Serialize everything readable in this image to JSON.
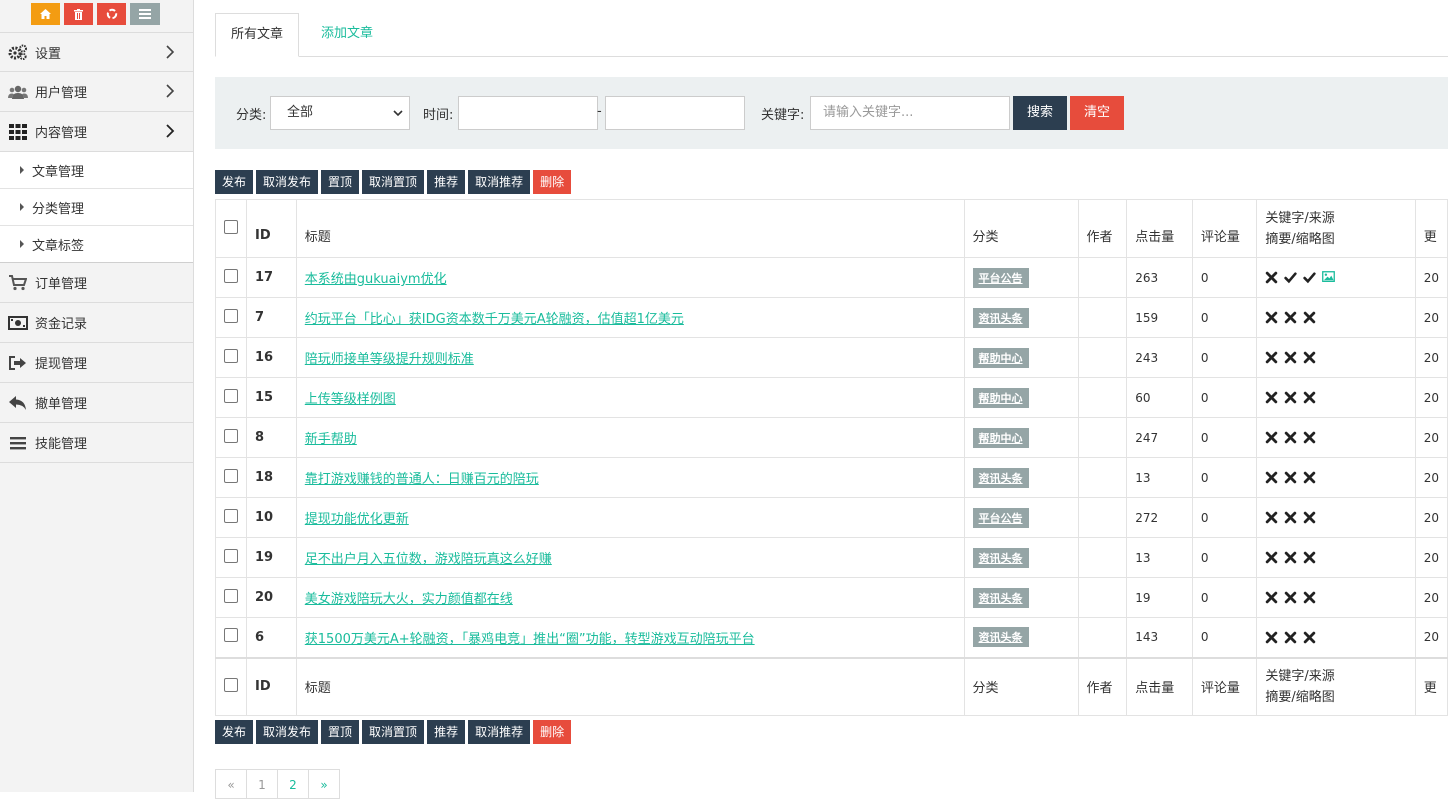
{
  "sidebar": {
    "quick_buttons": [
      {
        "icon": "home-icon",
        "color": "#f39c12"
      },
      {
        "icon": "trash-icon",
        "color": "#e74c3c"
      },
      {
        "icon": "recycle-icon",
        "color": "#e74c3c"
      },
      {
        "icon": "list-icon",
        "color": "#95a5a6"
      }
    ],
    "menu": [
      {
        "label": "设置",
        "icon": "gears-icon",
        "expandable": true
      },
      {
        "label": "用户管理",
        "icon": "users-icon",
        "expandable": true
      },
      {
        "label": "内容管理",
        "icon": "grid-icon",
        "expandable": true,
        "expanded": true
      }
    ],
    "submenu": [
      {
        "label": "文章管理"
      },
      {
        "label": "分类管理"
      },
      {
        "label": "文章标签"
      }
    ],
    "menu_bottom": [
      {
        "label": "订单管理",
        "icon": "cart-icon"
      },
      {
        "label": "资金记录",
        "icon": "money-icon"
      },
      {
        "label": "提现管理",
        "icon": "sign-out-icon"
      },
      {
        "label": "撤单管理",
        "icon": "reply-icon"
      },
      {
        "label": "技能管理",
        "icon": "bars-icon"
      }
    ]
  },
  "tabs": {
    "active": "所有文章",
    "add": "添加文章"
  },
  "filter": {
    "category_label": "分类:",
    "category_value": "全部",
    "time_label": "时间:",
    "time_separator": "-",
    "keyword_label": "关键字:",
    "keyword_placeholder": "请输入关键字...",
    "search_button": "搜索",
    "clear_button": "清空"
  },
  "actions": {
    "publish": "发布",
    "unpublish": "取消发布",
    "pin": "置顶",
    "unpin": "取消置顶",
    "recommend": "推荐",
    "unrecommend": "取消推荐",
    "delete": "删除"
  },
  "table": {
    "headers": {
      "id": "ID",
      "title": "标题",
      "category": "分类",
      "author": "作者",
      "hits": "点击量",
      "comments": "评论量",
      "kw_line1": "关键字/来源",
      "kw_line2": "摘要/缩略图",
      "more": "更"
    },
    "rows": [
      {
        "id": "17",
        "title": "本系统由gukuaiym优化",
        "category": "平台公告",
        "author": "",
        "hits": "263",
        "comments": "0",
        "flags": [
          "x",
          "check",
          "check",
          "image"
        ],
        "date": "20"
      },
      {
        "id": "7",
        "title": "约玩平台「比心」获IDG资本数千万美元A轮融资，估值超1亿美元",
        "category": "资讯头条",
        "author": "",
        "hits": "159",
        "comments": "0",
        "flags": [
          "x",
          "x",
          "x"
        ],
        "date": "20"
      },
      {
        "id": "16",
        "title": "陪玩师接单等级提升规则标准",
        "category": "帮助中心",
        "author": "",
        "hits": "243",
        "comments": "0",
        "flags": [
          "x",
          "x",
          "x"
        ],
        "date": "20"
      },
      {
        "id": "15",
        "title": "上传等级样例图",
        "category": "帮助中心",
        "author": "",
        "hits": "60",
        "comments": "0",
        "flags": [
          "x",
          "x",
          "x"
        ],
        "date": "20"
      },
      {
        "id": "8",
        "title": "新手帮助",
        "category": "帮助中心",
        "author": "",
        "hits": "247",
        "comments": "0",
        "flags": [
          "x",
          "x",
          "x"
        ],
        "date": "20"
      },
      {
        "id": "18",
        "title": "靠打游戏赚钱的普通人：日赚百元的陪玩",
        "category": "资讯头条",
        "author": "",
        "hits": "13",
        "comments": "0",
        "flags": [
          "x",
          "x",
          "x"
        ],
        "date": "20"
      },
      {
        "id": "10",
        "title": "提现功能优化更新",
        "category": "平台公告",
        "author": "",
        "hits": "272",
        "comments": "0",
        "flags": [
          "x",
          "x",
          "x"
        ],
        "date": "20"
      },
      {
        "id": "19",
        "title": "足不出户月入五位数，游戏陪玩真这么好赚",
        "category": "资讯头条",
        "author": "",
        "hits": "13",
        "comments": "0",
        "flags": [
          "x",
          "x",
          "x"
        ],
        "date": "20"
      },
      {
        "id": "20",
        "title": "美女游戏陪玩大火，实力颜值都在线",
        "category": "资讯头条",
        "author": "",
        "hits": "19",
        "comments": "0",
        "flags": [
          "x",
          "x",
          "x"
        ],
        "date": "20"
      },
      {
        "id": "6",
        "title": "获1500万美元A+轮融资，「暴鸡电竞」推出“圈”功能，转型游戏互动陪玩平台",
        "category": "资讯头条",
        "author": "",
        "hits": "143",
        "comments": "0",
        "flags": [
          "x",
          "x",
          "x"
        ],
        "date": "20"
      }
    ]
  },
  "pagination": {
    "prev": "«",
    "pages": [
      "1",
      "2"
    ],
    "next": "»"
  },
  "colors": {
    "accent": "#1abc9c",
    "dark_button": "#2c3e50",
    "danger": "#e74c3c",
    "badge": "#95a5a6",
    "warning": "#f39c12"
  }
}
